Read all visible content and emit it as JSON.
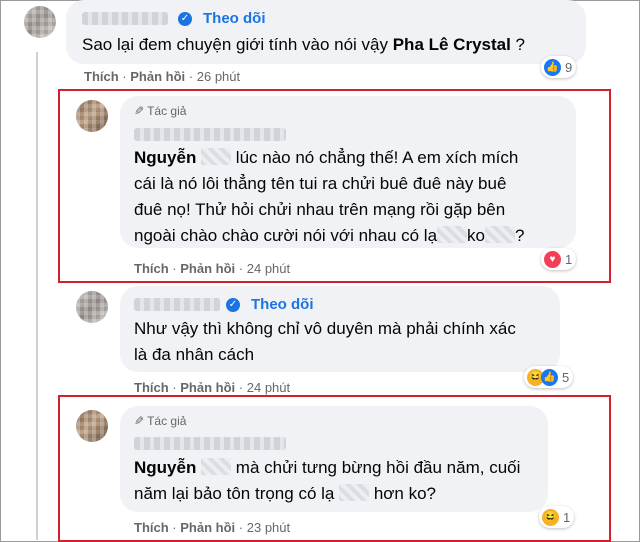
{
  "comments": [
    {
      "follow_label": "Theo dõi",
      "text_plain": "Sao lại đem chuyện giới tính vào nói vậy ",
      "text_bold": "Pha Lê Crystal",
      "text_after": " ?",
      "actions": {
        "like": "Thích",
        "reply": "Phản hồi",
        "sep": "·",
        "time": "26 phút"
      },
      "reactions": {
        "count": "9",
        "icons": [
          "like-icon"
        ]
      }
    },
    {
      "author_label": "Tác giả",
      "mention": "Nguyễn",
      "text_l1": " lúc nào nó chẳng thế! A em xích mích",
      "text_l2": "cái là nó lôi thẳng tên tui ra chửi buê đuê này buê",
      "text_l3": "đuê nọ! Thử hỏi chửi nhau trên mạng rồi gặp bên",
      "text_l4a": "ngoài chào chào cười nói với nhau có lạ",
      "text_l4b": "ko",
      "text_l4c": "?",
      "actions": {
        "like": "Thích",
        "reply": "Phản hồi",
        "sep": "·",
        "time": "24 phút"
      },
      "reactions": {
        "count": "1",
        "icons": [
          "love-icon"
        ]
      }
    },
    {
      "follow_label": "Theo dõi",
      "text_l1": "Như vậy thì không chỉ vô duyên mà phải chính xác",
      "text_l2": "là đa nhân cách",
      "actions": {
        "like": "Thích",
        "reply": "Phản hồi",
        "sep": "·",
        "time": "24 phút"
      },
      "reactions": {
        "count": "5",
        "icons": [
          "haha-icon",
          "like-icon"
        ]
      }
    },
    {
      "author_label": "Tác giả",
      "mention": "Nguyễn",
      "text_l1": " mà chửi tưng bừng hồi đầu năm, cuối",
      "text_l2a": "năm lại bảo tôn trọng có lạ",
      "text_l2b": " hơn ko?",
      "actions": {
        "like": "Thích",
        "reply": "Phản hồi",
        "sep": "·",
        "time": "23 phút"
      },
      "reactions": {
        "count": "1",
        "icons": [
          "haha-icon"
        ]
      }
    }
  ],
  "colors": {
    "accent": "#1b74e4",
    "highlight": "#d4202c",
    "bubble": "#f0f2f5",
    "meta": "#65676b"
  }
}
